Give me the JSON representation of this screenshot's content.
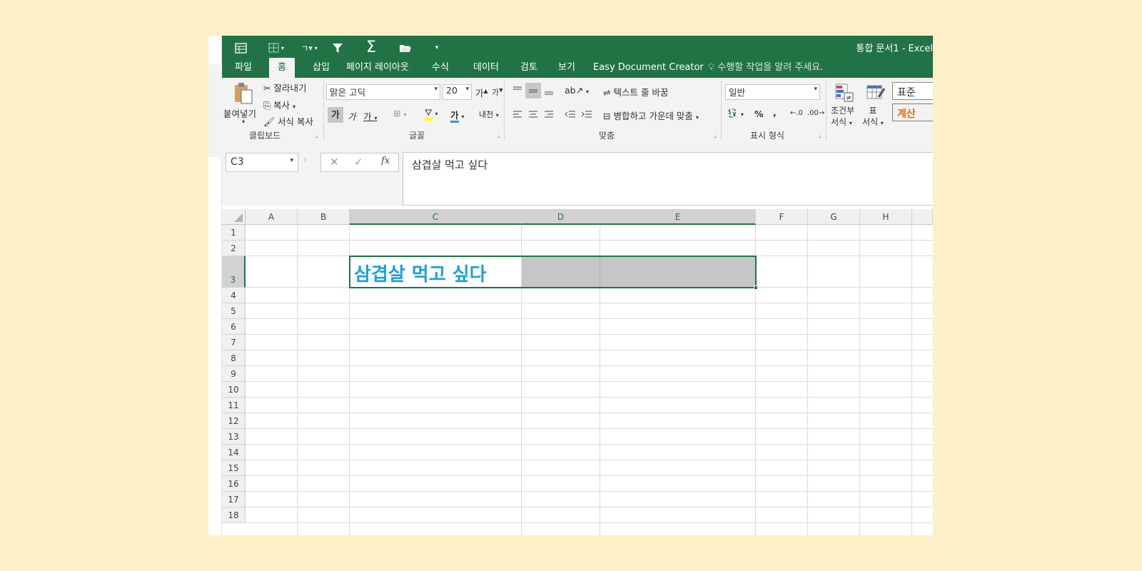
{
  "app": {
    "title": "통합 문서1 - Excel"
  },
  "quick_access": [
    {
      "icon": "form-icon"
    },
    {
      "icon": "borders-icon"
    },
    {
      "icon": "sort-icon",
      "label": "ㄱ"
    },
    {
      "icon": "filter-icon"
    },
    {
      "icon": "autosum-icon"
    },
    {
      "icon": "open-folder-icon"
    },
    {
      "icon": "customize-qat-icon"
    }
  ],
  "tabs": [
    "파일",
    "홈",
    "삽입",
    "페이지 레이아웃",
    "수식",
    "데이터",
    "검토",
    "보기",
    "Easy Document Creator"
  ],
  "active_tab": "홈",
  "tell_me": "수행할 작업을 알려 주세요.",
  "ribbon": {
    "clipboard": {
      "paste": "붙여넣기",
      "cut": "잘라내기",
      "copy": "복사",
      "format_painter": "서식 복사",
      "group": "클립보드"
    },
    "font": {
      "name": "맑은 고딕",
      "size": "20",
      "grow": "가",
      "shrink": "가",
      "bold": "가",
      "italic": "가",
      "underline": "가",
      "font_color": "가",
      "phonetic": "내천",
      "group": "글꼴"
    },
    "alignment": {
      "wrap_text": "텍스트 줄 바꿈",
      "merge_center": "병합하고 가운데 맞춤",
      "group": "맞춤"
    },
    "number": {
      "format": "일반",
      "percent": "%",
      "comma": ",",
      "group": "표시 형식"
    },
    "styles": {
      "conditional": [
        "조건부",
        "서식"
      ],
      "table": [
        "표",
        "서식"
      ],
      "style_normal": "표준",
      "style_calc": "계산",
      "calc_color": "#e46c0a"
    }
  },
  "formula_bar": {
    "name_box": "C3",
    "cancel": "✕",
    "enter": "✓",
    "fx": "fx",
    "content": "삼겹살 먹고 싶다"
  },
  "sheet": {
    "columns": [
      "A",
      "B",
      "C",
      "D",
      "E",
      "F",
      "G",
      "H"
    ],
    "selected_columns": [
      "C",
      "D",
      "E"
    ],
    "rows": [
      "1",
      "2",
      "3",
      "4",
      "5",
      "6",
      "7",
      "8",
      "9",
      "10",
      "11",
      "12",
      "13",
      "14",
      "15",
      "16",
      "17",
      "18"
    ],
    "selected_row": "3",
    "active_cell": "C3",
    "cell_text": "삼겹살 먹고 싶다",
    "cell_text_color": "#1ea0dc",
    "accent": "#217346"
  }
}
